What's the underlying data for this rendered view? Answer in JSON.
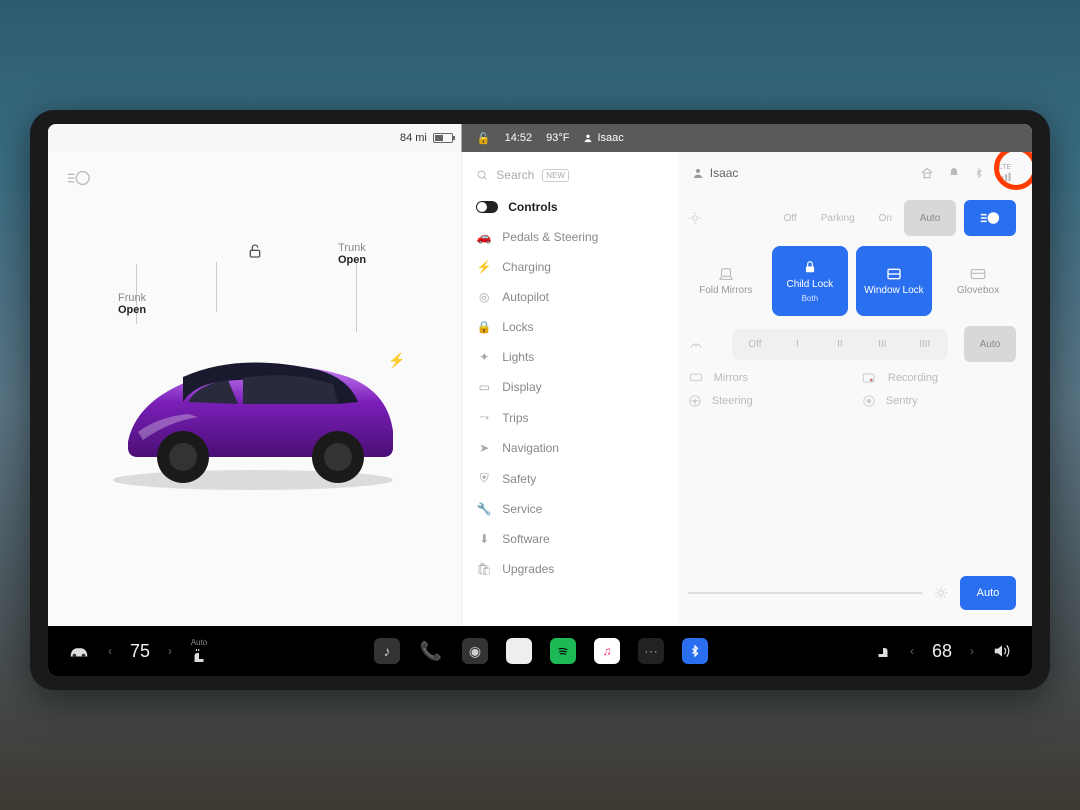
{
  "status": {
    "range": "84 mi",
    "time": "14:52",
    "temp": "93°F",
    "user": "Isaac"
  },
  "left": {
    "frunk_label": "Frunk",
    "frunk_state": "Open",
    "trunk_label": "Trunk",
    "trunk_state": "Open"
  },
  "search": {
    "placeholder": "Search",
    "badge": "NEW"
  },
  "menu": [
    {
      "label": "Controls",
      "icon": "toggle"
    },
    {
      "label": "Pedals & Steering",
      "icon": "car"
    },
    {
      "label": "Charging",
      "icon": "bolt"
    },
    {
      "label": "Autopilot",
      "icon": "wheel"
    },
    {
      "label": "Locks",
      "icon": "lock"
    },
    {
      "label": "Lights",
      "icon": "light"
    },
    {
      "label": "Display",
      "icon": "display"
    },
    {
      "label": "Trips",
      "icon": "route"
    },
    {
      "label": "Navigation",
      "icon": "nav"
    },
    {
      "label": "Safety",
      "icon": "shield"
    },
    {
      "label": "Service",
      "icon": "wrench"
    },
    {
      "label": "Software",
      "icon": "download"
    },
    {
      "label": "Upgrades",
      "icon": "bag"
    }
  ],
  "top": {
    "user": "Isaac",
    "lte": "LTE"
  },
  "lights": {
    "off": "Off",
    "parking": "Parking",
    "on": "On",
    "auto": "Auto"
  },
  "tiles": {
    "fold": "Fold Mirrors",
    "childlock": "Child Lock",
    "childlock_sub": "Both",
    "windowlock": "Window Lock",
    "glovebox": "Glovebox"
  },
  "wiper": {
    "off": "Off",
    "l1": "I",
    "l2": "II",
    "l3": "III",
    "l4": "IIII",
    "auto": "Auto"
  },
  "shortcuts": {
    "mirrors": "Mirrors",
    "recording": "Recording",
    "steering": "Steering",
    "sentry": "Sentry"
  },
  "brightness": {
    "auto": "Auto"
  },
  "dock": {
    "left_temp": "75",
    "right_temp": "68",
    "seat_auto": "Auto"
  }
}
